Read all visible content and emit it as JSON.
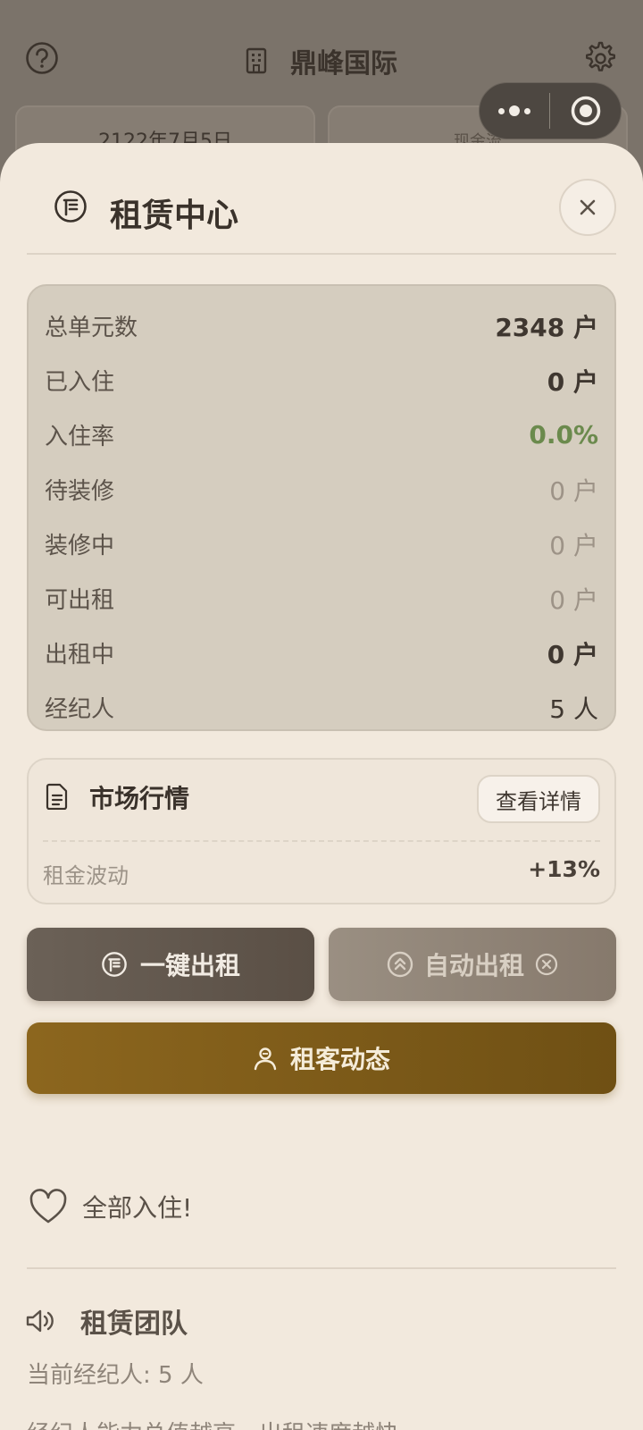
{
  "background": {
    "title": "鼎峰国际",
    "date_card": "2122年7月5日",
    "cash_card": "现金流"
  },
  "sheet": {
    "title": "租赁中心",
    "stats": [
      {
        "label": "总单元数",
        "value": "2348 户",
        "style": "bold"
      },
      {
        "label": "已入住",
        "value": "0 户",
        "style": "bold"
      },
      {
        "label": "入住率",
        "value": "0.0%",
        "style": "green"
      },
      {
        "label": "待装修",
        "value": "0 户",
        "style": "muted"
      },
      {
        "label": "装修中",
        "value": "0 户",
        "style": "muted"
      },
      {
        "label": "可出租",
        "value": "0 户",
        "style": "muted"
      },
      {
        "label": "出租中",
        "value": "0 户",
        "style": "bold"
      },
      {
        "label": "经纪人",
        "value": "5 人",
        "style": "normal"
      }
    ],
    "market": {
      "title": "市场行情",
      "detail_button": "查看详情",
      "rent_label": "租金波动",
      "rent_value": "+13%"
    },
    "actions": {
      "one_click_rent": "一键出租",
      "auto_rent": "自动出租",
      "tenant_news": "租客动态"
    },
    "status_message": "全部入住!",
    "team": {
      "title": "租赁团队",
      "current_agents": "当前经纪人: 5 人",
      "description": "经纪人能力总值越高，出租速度越快"
    }
  },
  "colors": {
    "accent_gold": "#8c661e",
    "green_rate": "#6b8a4d",
    "sheet_bg": "#f2e9dd"
  }
}
